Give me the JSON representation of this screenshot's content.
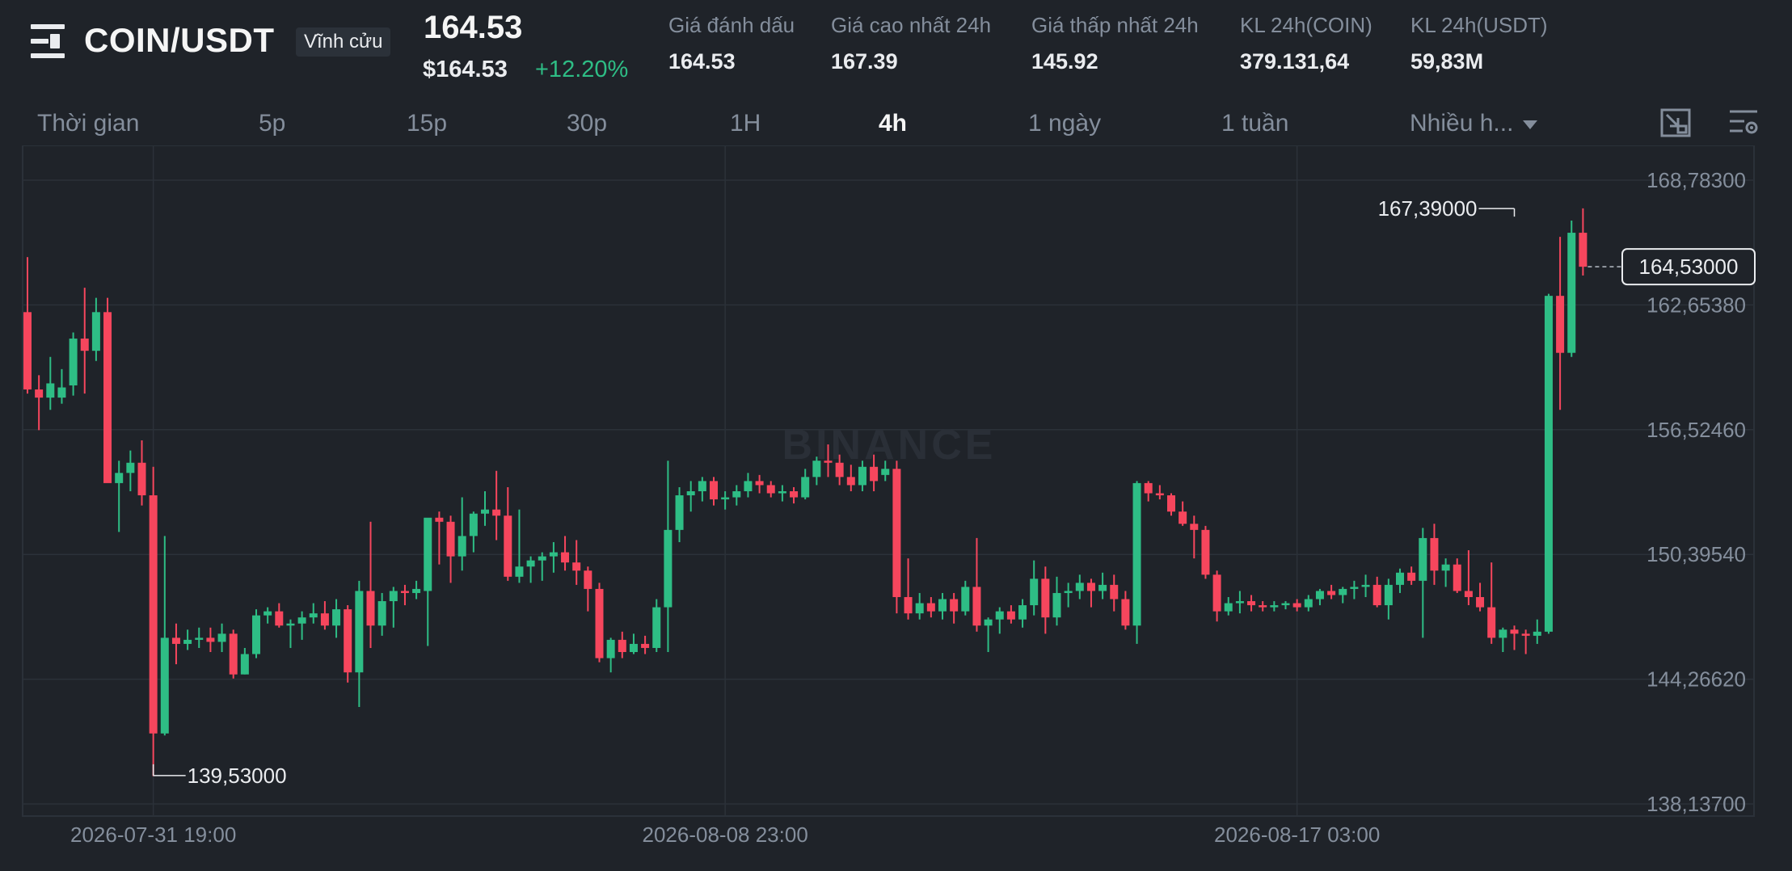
{
  "header": {
    "symbol": "COIN/USDT",
    "contract_type": "Vĩnh cửu",
    "last_price": "164.53",
    "usd_price": "$164.53",
    "change_pct": "+12.20%",
    "stats": [
      {
        "label": "Giá đánh dấu",
        "value": "164.53"
      },
      {
        "label": "Giá cao nhất 24h",
        "value": "167.39"
      },
      {
        "label": "Giá thấp nhất 24h",
        "value": "145.92"
      },
      {
        "label": "KL 24h(COIN)",
        "value": "379.131,64"
      },
      {
        "label": "KL 24h(USDT)",
        "value": "59,83M"
      }
    ]
  },
  "timeframes": {
    "label": "Thời gian",
    "items": [
      "5p",
      "15p",
      "30p",
      "1H",
      "4h",
      "1 ngày",
      "1 tuần"
    ],
    "active": "4h",
    "more": "Nhiều h..."
  },
  "toolbar_icons": [
    "chart-type-icon",
    "chart-settings-icon"
  ],
  "colors": {
    "up": "#2ebd85",
    "down": "#f6465d",
    "background": "#1f2329",
    "grid": "#2b3139"
  },
  "chart_data": {
    "type": "candlestick",
    "interval": "4h",
    "watermark": "BINANCE",
    "y_ticks": [
      "168,78300",
      "162,65380",
      "156,52460",
      "150,39540",
      "144,26620",
      "138,13700"
    ],
    "ylim": [
      138.137,
      168.783
    ],
    "x_ticks": [
      {
        "label": "2026-07-31 19:00",
        "index": 11
      },
      {
        "label": "2026-08-08 23:00",
        "index": 61
      },
      {
        "label": "2026-08-17 03:00",
        "index": 111
      }
    ],
    "last_price_label": "164,53000",
    "last_price": 164.53,
    "high_label": "167,39000",
    "high_value": 167.39,
    "high_index": 130,
    "low_label": "139,53000",
    "low_value": 139.53,
    "low_index": 11,
    "candles": [
      {
        "o": 162.3,
        "h": 165.0,
        "l": 158.3,
        "c": 158.5
      },
      {
        "o": 158.5,
        "h": 159.2,
        "l": 156.5,
        "c": 158.1
      },
      {
        "o": 158.1,
        "h": 160.1,
        "l": 157.5,
        "c": 158.8
      },
      {
        "o": 158.1,
        "h": 159.5,
        "l": 157.8,
        "c": 158.6
      },
      {
        "o": 158.7,
        "h": 161.3,
        "l": 158.2,
        "c": 161.0
      },
      {
        "o": 161.0,
        "h": 163.5,
        "l": 158.3,
        "c": 160.4
      },
      {
        "o": 160.4,
        "h": 163.0,
        "l": 159.9,
        "c": 162.3
      },
      {
        "o": 162.3,
        "h": 163.0,
        "l": 159.8,
        "c": 153.9
      },
      {
        "o": 153.9,
        "h": 155.0,
        "l": 151.5,
        "c": 154.4
      },
      {
        "o": 154.4,
        "h": 155.5,
        "l": 153.5,
        "c": 154.9
      },
      {
        "o": 154.9,
        "h": 156.0,
        "l": 152.8,
        "c": 153.3
      },
      {
        "o": 153.3,
        "h": 154.7,
        "l": 139.5,
        "c": 141.6
      },
      {
        "o": 141.6,
        "h": 151.3,
        "l": 141.5,
        "c": 146.3
      },
      {
        "o": 146.3,
        "h": 147.0,
        "l": 145.0,
        "c": 146.0
      },
      {
        "o": 146.0,
        "h": 146.7,
        "l": 145.7,
        "c": 146.2
      },
      {
        "o": 146.2,
        "h": 146.8,
        "l": 145.8,
        "c": 146.3
      },
      {
        "o": 146.3,
        "h": 146.8,
        "l": 145.6,
        "c": 146.1
      },
      {
        "o": 146.1,
        "h": 147.0,
        "l": 145.6,
        "c": 146.5
      },
      {
        "o": 146.5,
        "h": 146.7,
        "l": 144.3,
        "c": 144.5
      },
      {
        "o": 144.5,
        "h": 145.8,
        "l": 144.5,
        "c": 145.5
      },
      {
        "o": 145.5,
        "h": 147.7,
        "l": 145.3,
        "c": 147.4
      },
      {
        "o": 147.4,
        "h": 147.8,
        "l": 147.0,
        "c": 147.6
      },
      {
        "o": 147.6,
        "h": 148.0,
        "l": 146.8,
        "c": 146.9
      },
      {
        "o": 146.9,
        "h": 147.2,
        "l": 145.8,
        "c": 147.0
      },
      {
        "o": 147.0,
        "h": 147.6,
        "l": 146.2,
        "c": 147.3
      },
      {
        "o": 147.3,
        "h": 148.0,
        "l": 147.0,
        "c": 147.5
      },
      {
        "o": 147.5,
        "h": 148.1,
        "l": 146.7,
        "c": 146.9
      },
      {
        "o": 146.9,
        "h": 148.2,
        "l": 146.3,
        "c": 147.7
      },
      {
        "o": 147.7,
        "h": 147.9,
        "l": 144.1,
        "c": 144.6
      },
      {
        "o": 144.6,
        "h": 149.1,
        "l": 142.9,
        "c": 148.6
      },
      {
        "o": 148.6,
        "h": 152.0,
        "l": 145.8,
        "c": 146.9
      },
      {
        "o": 146.9,
        "h": 148.5,
        "l": 146.4,
        "c": 148.1
      },
      {
        "o": 148.1,
        "h": 148.8,
        "l": 146.8,
        "c": 148.6
      },
      {
        "o": 148.6,
        "h": 148.9,
        "l": 147.9,
        "c": 148.5
      },
      {
        "o": 148.5,
        "h": 149.1,
        "l": 148.2,
        "c": 148.7
      },
      {
        "o": 148.6,
        "h": 152.0,
        "l": 145.9,
        "c": 152.2
      },
      {
        "o": 152.2,
        "h": 152.5,
        "l": 149.9,
        "c": 152.0
      },
      {
        "o": 152.0,
        "h": 152.3,
        "l": 149.0,
        "c": 150.3
      },
      {
        "o": 150.3,
        "h": 153.2,
        "l": 149.6,
        "c": 151.3
      },
      {
        "o": 151.3,
        "h": 152.5,
        "l": 150.5,
        "c": 152.4
      },
      {
        "o": 152.4,
        "h": 153.5,
        "l": 151.8,
        "c": 152.6
      },
      {
        "o": 152.6,
        "h": 154.5,
        "l": 151.1,
        "c": 152.3
      },
      {
        "o": 152.3,
        "h": 153.7,
        "l": 149.1,
        "c": 149.3
      },
      {
        "o": 149.3,
        "h": 152.6,
        "l": 149.0,
        "c": 149.8
      },
      {
        "o": 149.8,
        "h": 150.3,
        "l": 149.0,
        "c": 150.1
      },
      {
        "o": 150.1,
        "h": 150.5,
        "l": 149.1,
        "c": 150.3
      },
      {
        "o": 150.3,
        "h": 151.0,
        "l": 149.5,
        "c": 150.5
      },
      {
        "o": 150.5,
        "h": 151.3,
        "l": 149.6,
        "c": 150.0
      },
      {
        "o": 150.0,
        "h": 151.1,
        "l": 148.9,
        "c": 149.6
      },
      {
        "o": 149.6,
        "h": 149.8,
        "l": 147.6,
        "c": 148.7
      },
      {
        "o": 148.7,
        "h": 149.0,
        "l": 145.1,
        "c": 145.3
      },
      {
        "o": 145.3,
        "h": 146.3,
        "l": 144.6,
        "c": 146.2
      },
      {
        "o": 146.2,
        "h": 146.6,
        "l": 145.3,
        "c": 145.6
      },
      {
        "o": 145.6,
        "h": 146.5,
        "l": 145.5,
        "c": 146.0
      },
      {
        "o": 146.0,
        "h": 146.4,
        "l": 145.5,
        "c": 145.8
      },
      {
        "o": 145.8,
        "h": 148.2,
        "l": 145.6,
        "c": 147.8
      },
      {
        "o": 147.8,
        "h": 155.0,
        "l": 145.6,
        "c": 151.6
      },
      {
        "o": 151.6,
        "h": 153.7,
        "l": 151.0,
        "c": 153.3
      },
      {
        "o": 153.3,
        "h": 154.0,
        "l": 152.5,
        "c": 153.5
      },
      {
        "o": 153.5,
        "h": 154.2,
        "l": 153.0,
        "c": 154.0
      },
      {
        "o": 154.0,
        "h": 154.2,
        "l": 152.8,
        "c": 153.1
      },
      {
        "o": 153.1,
        "h": 153.5,
        "l": 152.6,
        "c": 153.2
      },
      {
        "o": 153.2,
        "h": 153.8,
        "l": 152.8,
        "c": 153.5
      },
      {
        "o": 153.5,
        "h": 154.4,
        "l": 153.2,
        "c": 154.0
      },
      {
        "o": 154.0,
        "h": 154.3,
        "l": 153.4,
        "c": 153.8
      },
      {
        "o": 153.8,
        "h": 154.0,
        "l": 153.2,
        "c": 153.4
      },
      {
        "o": 153.4,
        "h": 153.8,
        "l": 153.0,
        "c": 153.5
      },
      {
        "o": 153.5,
        "h": 153.7,
        "l": 152.9,
        "c": 153.2
      },
      {
        "o": 153.2,
        "h": 154.6,
        "l": 153.1,
        "c": 154.2
      },
      {
        "o": 154.2,
        "h": 155.2,
        "l": 153.8,
        "c": 155.0
      },
      {
        "o": 155.0,
        "h": 155.8,
        "l": 154.2,
        "c": 154.9
      },
      {
        "o": 154.9,
        "h": 155.3,
        "l": 153.8,
        "c": 154.2
      },
      {
        "o": 154.2,
        "h": 154.8,
        "l": 153.5,
        "c": 153.8
      },
      {
        "o": 153.8,
        "h": 155.0,
        "l": 153.5,
        "c": 154.7
      },
      {
        "o": 154.7,
        "h": 155.3,
        "l": 153.5,
        "c": 154.0
      },
      {
        "o": 154.3,
        "h": 155.0,
        "l": 154.0,
        "c": 154.6
      },
      {
        "o": 154.6,
        "h": 155.0,
        "l": 147.5,
        "c": 148.3
      },
      {
        "o": 148.3,
        "h": 150.2,
        "l": 147.2,
        "c": 147.5
      },
      {
        "o": 147.5,
        "h": 148.5,
        "l": 147.2,
        "c": 148.0
      },
      {
        "o": 148.0,
        "h": 148.3,
        "l": 147.3,
        "c": 147.6
      },
      {
        "o": 147.6,
        "h": 148.5,
        "l": 147.2,
        "c": 148.2
      },
      {
        "o": 148.2,
        "h": 148.5,
        "l": 147.0,
        "c": 147.6
      },
      {
        "o": 147.6,
        "h": 149.1,
        "l": 147.4,
        "c": 148.8
      },
      {
        "o": 148.8,
        "h": 151.2,
        "l": 146.6,
        "c": 146.9
      },
      {
        "o": 146.9,
        "h": 147.3,
        "l": 145.6,
        "c": 147.2
      },
      {
        "o": 147.2,
        "h": 147.8,
        "l": 146.5,
        "c": 147.6
      },
      {
        "o": 147.6,
        "h": 147.9,
        "l": 147.0,
        "c": 147.2
      },
      {
        "o": 147.2,
        "h": 148.2,
        "l": 146.8,
        "c": 147.9
      },
      {
        "o": 147.9,
        "h": 150.1,
        "l": 147.4,
        "c": 149.2
      },
      {
        "o": 149.2,
        "h": 149.8,
        "l": 146.5,
        "c": 147.3
      },
      {
        "o": 147.3,
        "h": 149.3,
        "l": 146.9,
        "c": 148.5
      },
      {
        "o": 148.5,
        "h": 149.0,
        "l": 147.8,
        "c": 148.6
      },
      {
        "o": 148.6,
        "h": 149.4,
        "l": 148.2,
        "c": 149.0
      },
      {
        "o": 149.0,
        "h": 149.2,
        "l": 147.8,
        "c": 148.6
      },
      {
        "o": 148.6,
        "h": 149.5,
        "l": 148.2,
        "c": 148.9
      },
      {
        "o": 148.9,
        "h": 149.4,
        "l": 147.6,
        "c": 148.2
      },
      {
        "o": 148.2,
        "h": 148.6,
        "l": 146.7,
        "c": 146.9
      },
      {
        "o": 146.9,
        "h": 154.0,
        "l": 146.0,
        "c": 153.9
      },
      {
        "o": 153.9,
        "h": 154.0,
        "l": 153.0,
        "c": 153.4
      },
      {
        "o": 153.4,
        "h": 153.8,
        "l": 153.1,
        "c": 153.3
      },
      {
        "o": 153.3,
        "h": 153.4,
        "l": 152.3,
        "c": 152.5
      },
      {
        "o": 152.5,
        "h": 153.0,
        "l": 151.8,
        "c": 151.9
      },
      {
        "o": 151.9,
        "h": 152.3,
        "l": 150.2,
        "c": 151.6
      },
      {
        "o": 151.6,
        "h": 151.8,
        "l": 149.2,
        "c": 149.4
      },
      {
        "o": 149.4,
        "h": 149.6,
        "l": 147.1,
        "c": 147.6
      },
      {
        "o": 147.6,
        "h": 148.3,
        "l": 147.4,
        "c": 148.0
      },
      {
        "o": 148.0,
        "h": 148.6,
        "l": 147.5,
        "c": 148.1
      },
      {
        "o": 148.1,
        "h": 148.4,
        "l": 147.6,
        "c": 147.9
      },
      {
        "o": 147.9,
        "h": 148.1,
        "l": 147.6,
        "c": 147.8
      },
      {
        "o": 147.8,
        "h": 148.1,
        "l": 147.6,
        "c": 147.9
      },
      {
        "o": 147.9,
        "h": 148.1,
        "l": 147.7,
        "c": 148.0
      },
      {
        "o": 148.0,
        "h": 148.2,
        "l": 147.6,
        "c": 147.8
      },
      {
        "o": 147.8,
        "h": 148.4,
        "l": 147.6,
        "c": 148.2
      },
      {
        "o": 148.2,
        "h": 148.7,
        "l": 147.9,
        "c": 148.6
      },
      {
        "o": 148.6,
        "h": 148.9,
        "l": 148.2,
        "c": 148.4
      },
      {
        "o": 148.4,
        "h": 148.8,
        "l": 148.0,
        "c": 148.7
      },
      {
        "o": 148.7,
        "h": 149.1,
        "l": 148.2,
        "c": 148.8
      },
      {
        "o": 148.8,
        "h": 149.4,
        "l": 148.3,
        "c": 148.9
      },
      {
        "o": 148.9,
        "h": 149.3,
        "l": 147.8,
        "c": 147.9
      },
      {
        "o": 147.9,
        "h": 149.2,
        "l": 147.2,
        "c": 148.9
      },
      {
        "o": 148.9,
        "h": 149.7,
        "l": 148.5,
        "c": 149.5
      },
      {
        "o": 149.5,
        "h": 149.8,
        "l": 148.9,
        "c": 149.1
      },
      {
        "o": 149.1,
        "h": 151.7,
        "l": 146.3,
        "c": 151.2
      },
      {
        "o": 151.2,
        "h": 151.9,
        "l": 148.9,
        "c": 149.6
      },
      {
        "o": 149.6,
        "h": 150.2,
        "l": 148.8,
        "c": 149.9
      },
      {
        "o": 149.9,
        "h": 150.2,
        "l": 148.5,
        "c": 148.6
      },
      {
        "o": 148.6,
        "h": 150.6,
        "l": 147.9,
        "c": 148.3
      },
      {
        "o": 148.3,
        "h": 149.0,
        "l": 147.6,
        "c": 147.8
      },
      {
        "o": 147.8,
        "h": 150.0,
        "l": 146.0,
        "c": 146.3
      },
      {
        "o": 146.3,
        "h": 146.8,
        "l": 145.6,
        "c": 146.7
      },
      {
        "o": 146.7,
        "h": 146.9,
        "l": 145.7,
        "c": 146.5
      },
      {
        "o": 146.5,
        "h": 146.7,
        "l": 145.5,
        "c": 146.4
      },
      {
        "o": 146.4,
        "h": 147.2,
        "l": 146.0,
        "c": 146.6
      },
      {
        "o": 146.6,
        "h": 163.2,
        "l": 146.5,
        "c": 163.1
      },
      {
        "o": 163.1,
        "h": 166.0,
        "l": 157.5,
        "c": 160.3
      },
      {
        "o": 160.3,
        "h": 166.8,
        "l": 160.1,
        "c": 166.2
      },
      {
        "o": 166.2,
        "h": 167.4,
        "l": 164.1,
        "c": 164.53
      }
    ]
  }
}
